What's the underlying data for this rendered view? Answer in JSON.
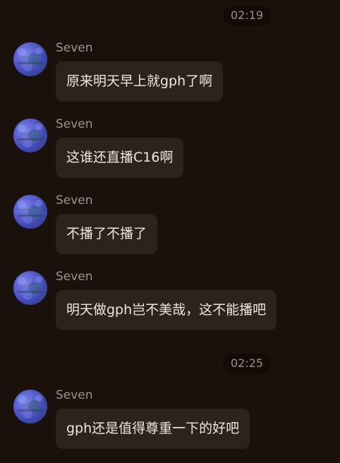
{
  "timestamps": [
    "02:19",
    "02:25"
  ],
  "messages": [
    {
      "sender": "Seven",
      "text": "原来明天早上就gph了啊"
    },
    {
      "sender": "Seven",
      "text": "这谁还直播C16啊"
    },
    {
      "sender": "Seven",
      "text": "不播了不播了"
    },
    {
      "sender": "Seven",
      "text": "明天做gph岂不美哉，这不能播吧"
    },
    {
      "sender": "Seven",
      "text": "gph还是值得尊重一下的好吧"
    }
  ],
  "colors": {
    "background": "#1a110d",
    "bubble": "#2c231d",
    "timestamp_pill": "#120b08",
    "sender_text": "#9c948e",
    "message_text": "#eee7e1"
  },
  "icons": {
    "avatar": "avatar-icon"
  }
}
